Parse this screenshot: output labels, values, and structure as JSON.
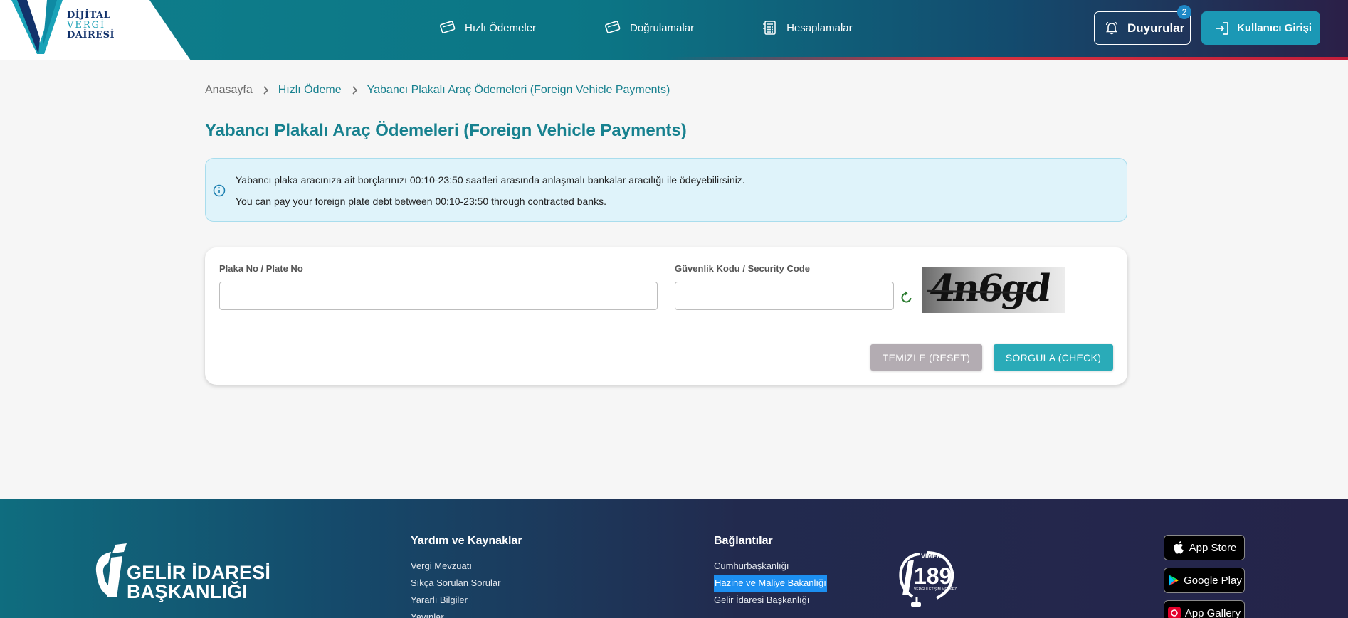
{
  "header": {
    "logo": {
      "line1": "DİJİTAL",
      "line2": "VERGİ",
      "line3": "DAİRESİ"
    },
    "nav": [
      {
        "label": "Hızlı Ödemeler",
        "icon": "payment-card-icon"
      },
      {
        "label": "Doğrulamalar",
        "icon": "verify-card-icon"
      },
      {
        "label": "Hesaplamalar",
        "icon": "calculator-icon"
      }
    ],
    "announcements": {
      "label": "Duyurular",
      "count": "2"
    },
    "login": {
      "label": "Kullanıcı Girişi"
    }
  },
  "breadcrumb": [
    "Anasayfa",
    "Hızlı Ödeme",
    "Yabancı Plakalı Araç Ödemeleri (Foreign Vehicle Payments)"
  ],
  "page_title": "Yabancı Plakalı Araç Ödemeleri (Foreign Vehicle Payments)",
  "info": {
    "line1": "Yabancı plaka aracınıza ait borçlarınızı 00:10-23:50 saatleri arasında anlaşmalı bankalar aracılığı ile ödeyebilirsiniz.",
    "line2": "You can pay your foreign plate debt between 00:10-23:50 through contracted banks."
  },
  "form": {
    "plate_label": "Plaka No / Plate No",
    "plate_value": "",
    "security_label": "Güvenlik Kodu / Security Code",
    "security_value": "",
    "captcha_text": "4n6gd",
    "reset_label": "TEMİZLE (RESET)",
    "check_label": "SORGULA (CHECK)"
  },
  "footer": {
    "gib": {
      "line1": "GELİR İDARESİ",
      "line2": "BAŞKANLIĞI"
    },
    "help": {
      "title": "Yardım ve Kaynaklar",
      "links": [
        "Vergi Mevzuatı",
        "Sıkça Sorulan Sorular",
        "Yararlı Bilgiler",
        "Yayınlar"
      ]
    },
    "links": {
      "title": "Bağlantılar",
      "items": [
        "Cumhurbaşkanlığı",
        "Hazine ve Maliye Bakanlığı",
        "Gelir İdaresi Başkanlığı"
      ]
    },
    "vimer": {
      "top": "VİMER",
      "number": "189",
      "sub": "VERGİ İLETİŞİM MERKEZİ"
    },
    "stores": [
      "App Store",
      "Google Play",
      "App Gallery"
    ]
  },
  "colors": {
    "primary": "#17818f",
    "accent_button": "#2aabb8",
    "info_bg": "#dff3fa",
    "highlight": "#1c8ff1"
  }
}
